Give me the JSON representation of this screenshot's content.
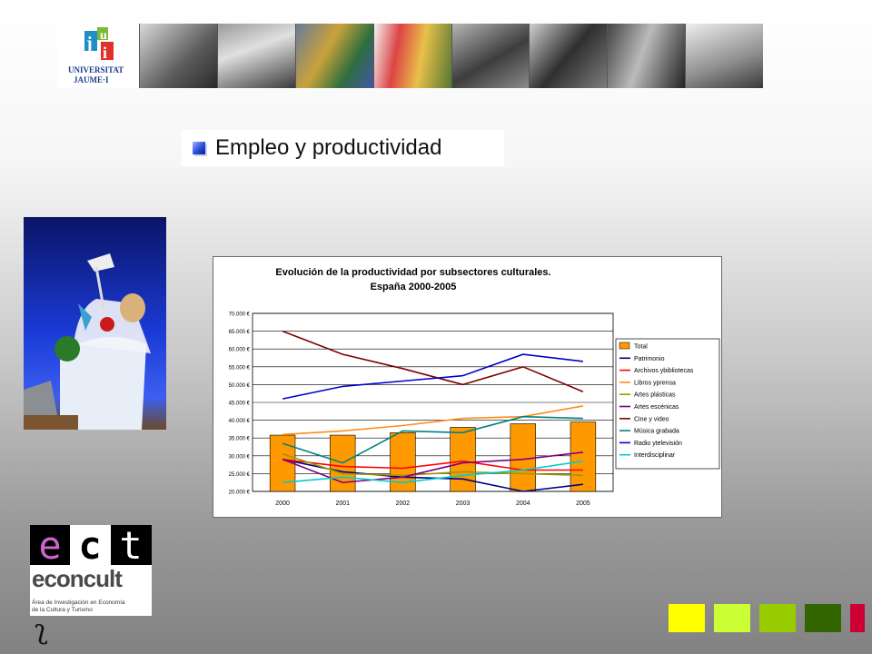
{
  "banner": {
    "logo_line1": "UNIVERSITAT",
    "logo_line2": "JAUME·I"
  },
  "slide": {
    "title": "Empleo y productividad"
  },
  "logo": {
    "letters": [
      "e",
      "c",
      "t"
    ],
    "name": "econcult",
    "subtitle_line1": "Área de Investigación en Economía",
    "subtitle_line2": "de la Cultura y Turismo"
  },
  "footer_glyph": "ʅ",
  "colors": {
    "square1": "#ffff00",
    "square2": "#ccff33",
    "square3": "#99cc00",
    "square4": "#336600",
    "square5": "#cc0033"
  },
  "chart_data": {
    "type": "bar",
    "title_line1": "Evolución de la productividad por subsectores culturales.",
    "title_line2": "España 2000-2005",
    "categories": [
      "2000",
      "2001",
      "2002",
      "2003",
      "2004",
      "2005"
    ],
    "y_ticks": [
      "20.000 €",
      "25.000 €",
      "30.000 €",
      "35.000 €",
      "40.000 €",
      "45.000 €",
      "50.000 €",
      "55.000 €",
      "60.000 €",
      "65.000 €",
      "70.000 €"
    ],
    "ylim": [
      20000,
      70000
    ],
    "grid": true,
    "legend_position": "right",
    "bar_series": {
      "name": "Total",
      "color": "#ff9900",
      "values": [
        35800,
        35800,
        36500,
        38000,
        39000,
        39500
      ]
    },
    "series": [
      {
        "name": "Patrimonio",
        "color": "#000080",
        "values": [
          29000,
          25500,
          24000,
          23500,
          20000,
          22000
        ]
      },
      {
        "name": "Archivos y bibliotecas",
        "color": "#ff0000",
        "values": [
          29000,
          27000,
          26500,
          28500,
          26000,
          26000
        ]
      },
      {
        "name": "Libros y prensa",
        "color": "#ff8c1a",
        "values": [
          36000,
          37000,
          38500,
          40500,
          41000,
          44000
        ]
      },
      {
        "name": "Artes plásticas",
        "color": "#999900",
        "values": [
          30500,
          25000,
          24500,
          25500,
          25000,
          24500
        ]
      },
      {
        "name": "Artes escénicas",
        "color": "#800080",
        "values": [
          29000,
          22500,
          24000,
          28000,
          29000,
          31000
        ]
      },
      {
        "name": "Cine y video",
        "color": "#800000",
        "values": [
          65000,
          58500,
          54500,
          50000,
          55000,
          48000
        ]
      },
      {
        "name": "Música grabada",
        "color": "#008080",
        "values": [
          33500,
          28000,
          37000,
          36500,
          41000,
          40500
        ]
      },
      {
        "name": "Radio y televisión",
        "color": "#0000cc",
        "values": [
          46000,
          49500,
          51000,
          52500,
          58500,
          56500
        ]
      },
      {
        "name": "Interdisciplinar",
        "color": "#00cccc",
        "values": [
          22500,
          24000,
          22500,
          24500,
          26000,
          28500
        ]
      }
    ],
    "legend": [
      "Total",
      "Patrimonio",
      "Archivos ybibliotecas",
      "Libros yprensa",
      "Artes plásticas",
      "Artes escénicas",
      "Cine y video",
      "Música grabada",
      "Radio ytelevisión",
      "Interdisciplinar"
    ]
  }
}
